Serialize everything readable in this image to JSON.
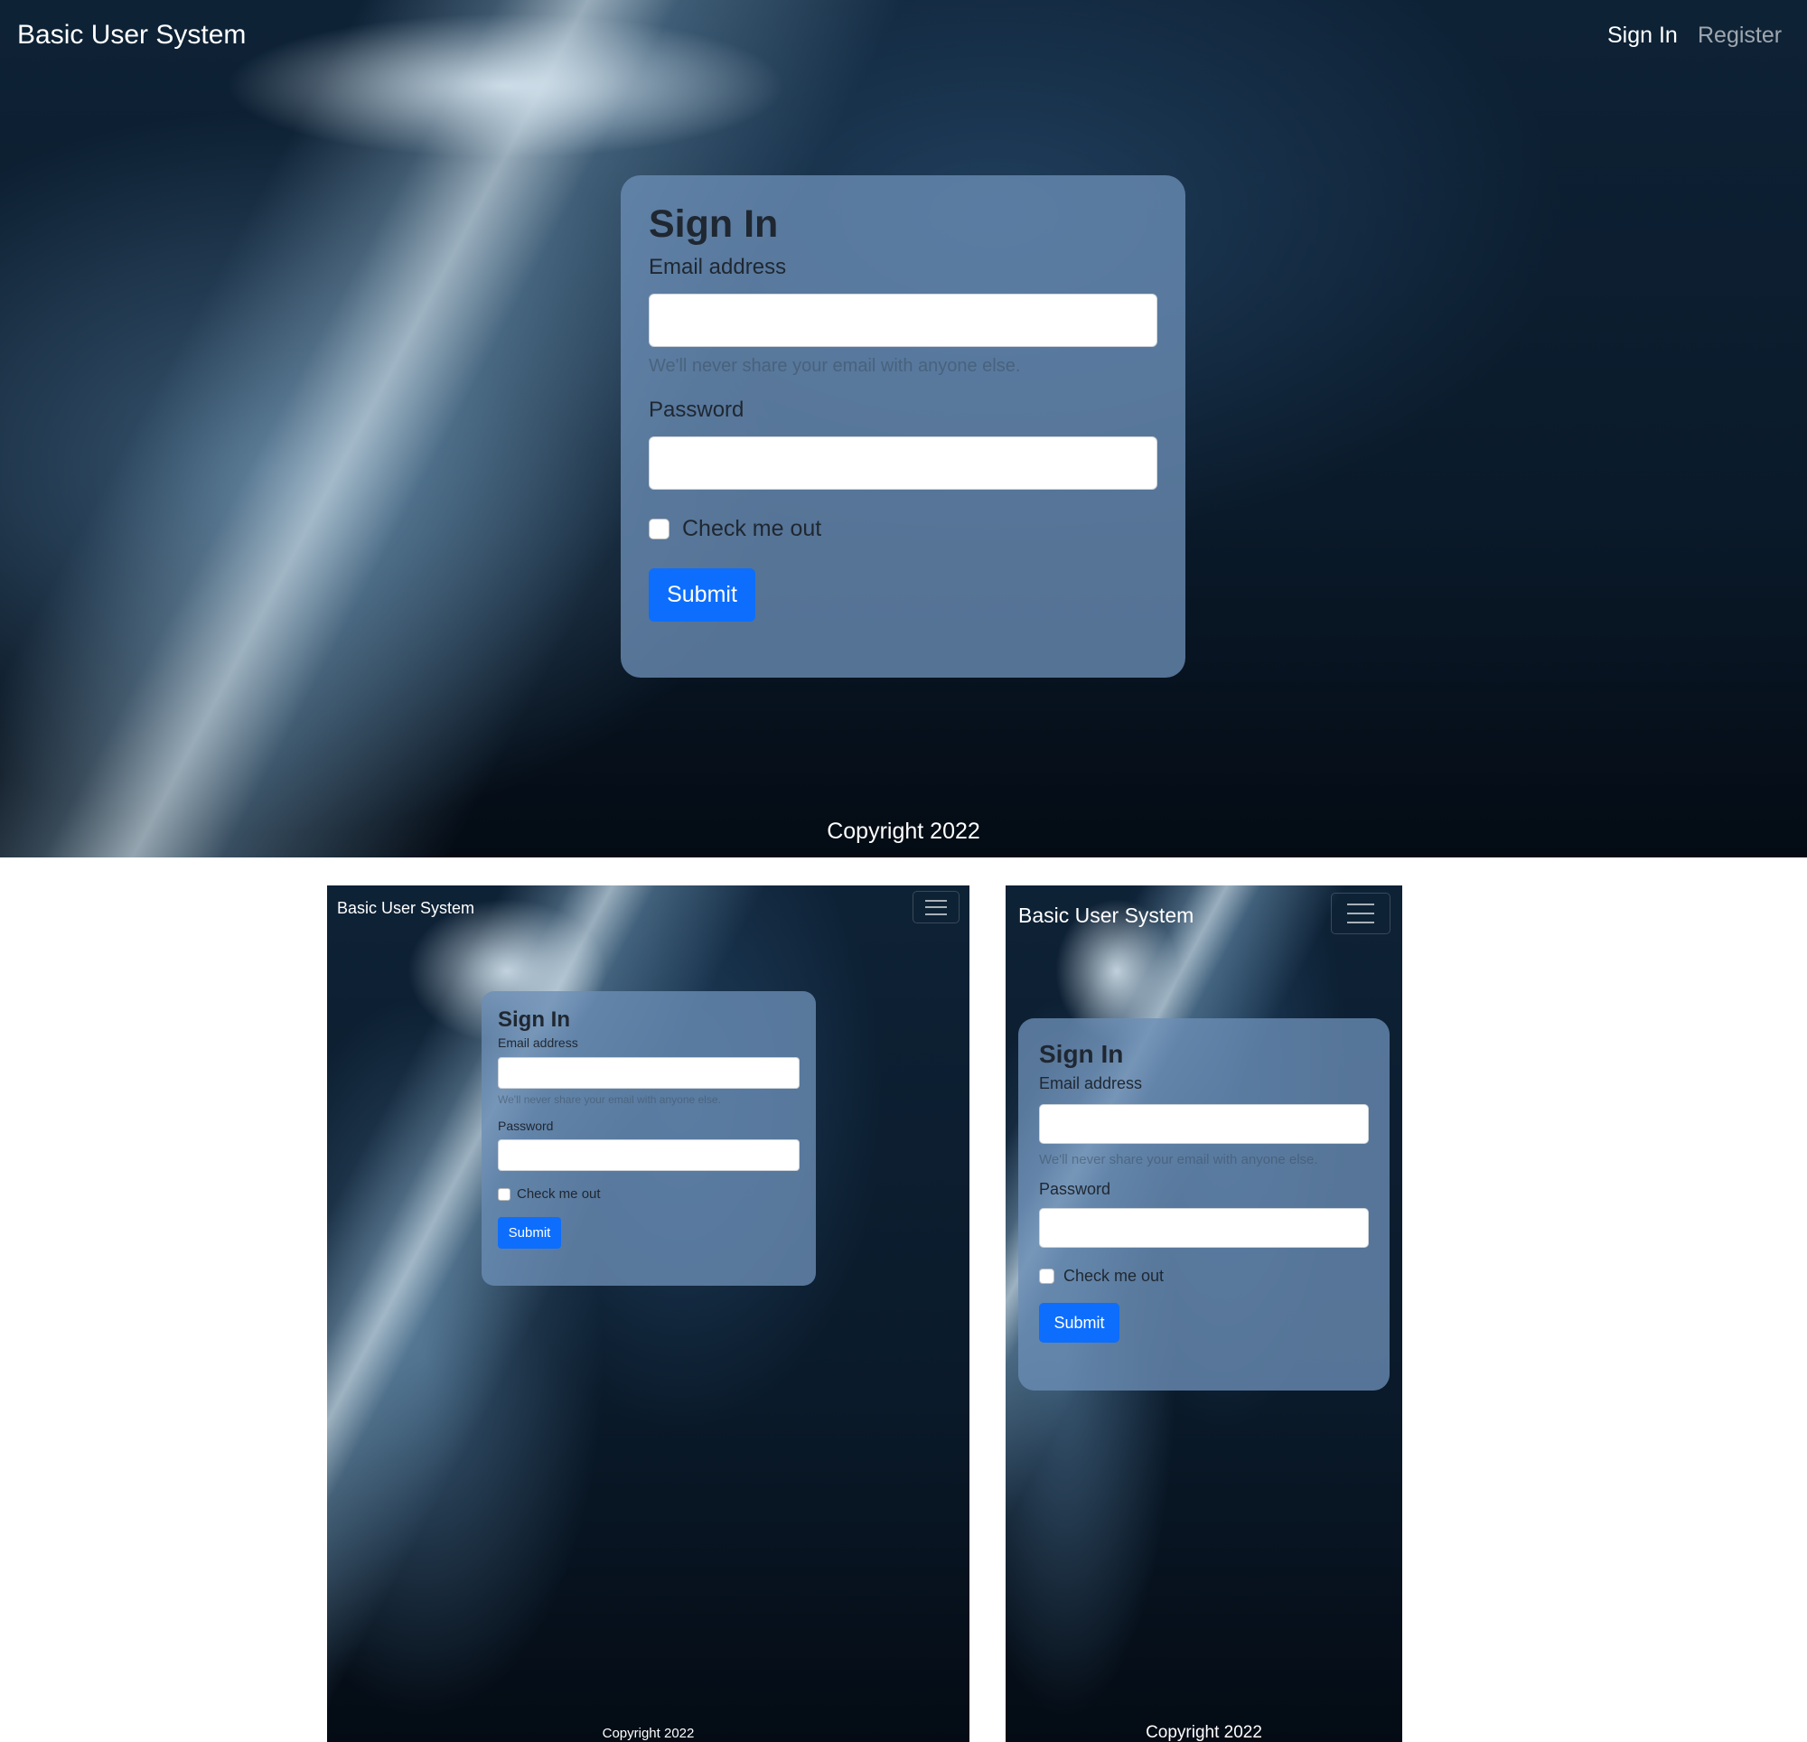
{
  "navbar": {
    "brand": "Basic User System",
    "links": [
      "Sign In",
      "Register"
    ]
  },
  "signin": {
    "title": "Sign In",
    "email_label": "Email address",
    "email_value": "",
    "email_help": "We'll never share your email with anyone else.",
    "password_label": "Password",
    "password_value": "",
    "checkbox_label": "Check me out",
    "checkbox_checked": false,
    "submit_label": "Submit"
  },
  "footer": {
    "text": "Copyright 2022"
  },
  "icons": {
    "menu": "hamburger-menu-icon",
    "checkbox": "checkbox-icon"
  },
  "colors": {
    "primary": "#0d6efd",
    "card": "#6c8eb6",
    "background": "#0a1a2a"
  }
}
